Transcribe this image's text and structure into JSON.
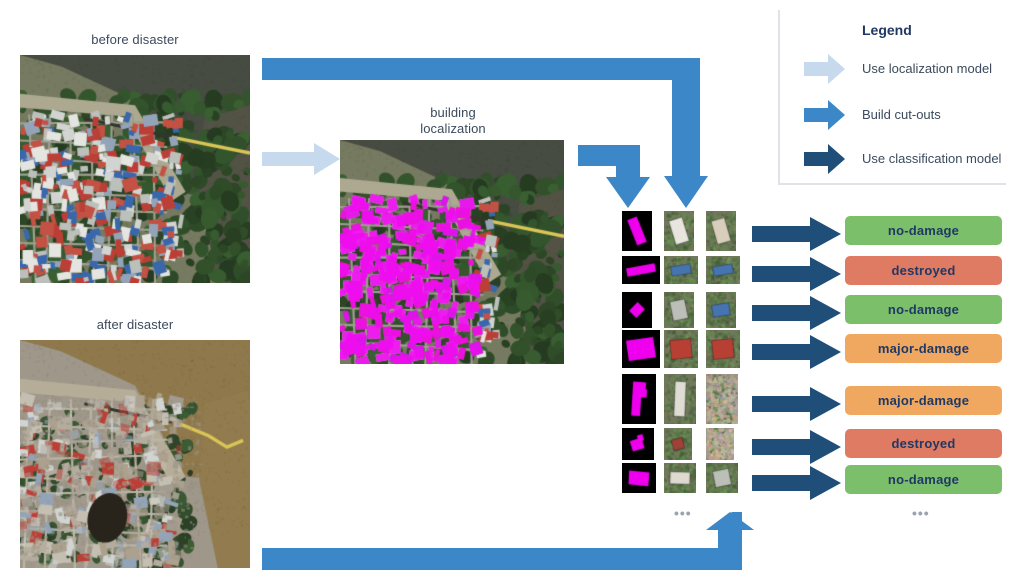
{
  "figure": {
    "captions": {
      "before": "before disaster",
      "after": "after disaster",
      "localization_line1": "building",
      "localization_line2": "localization"
    },
    "ellipsis": "•••"
  },
  "legend": {
    "title": "Legend",
    "items": [
      {
        "label": "Use localization model",
        "color": "#c6d9ed",
        "icon": "arrow-right-icon"
      },
      {
        "label": "Build cut-outs",
        "color": "#3b87c8",
        "icon": "arrow-right-icon"
      },
      {
        "label": "Use classification model",
        "color": "#1f4e79",
        "icon": "arrow-right-icon"
      }
    ]
  },
  "colors": {
    "light_blue": "#c6d9ed",
    "mid_blue": "#3b87c8",
    "dark_navy": "#1f4e79",
    "green": "#7cbf6b",
    "red": "#e07b63",
    "orange": "#f0a860",
    "badge_text": "#1f3864",
    "caption_text": "#3b4a5c",
    "mask_magenta": "#ee00ee",
    "legend_border": "#dfe3e8"
  },
  "classifications": [
    {
      "index": 1,
      "label": "no-damage",
      "color": "#7cbf6b"
    },
    {
      "index": 2,
      "label": "destroyed",
      "color": "#e07b63"
    },
    {
      "index": 3,
      "label": "no-damage",
      "color": "#7cbf6b"
    },
    {
      "index": 4,
      "label": "major-damage",
      "color": "#f0a860"
    },
    {
      "index": 5,
      "label": "major-damage",
      "color": "#f0a860"
    },
    {
      "index": 6,
      "label": "destroyed",
      "color": "#e07b63"
    },
    {
      "index": 7,
      "label": "no-damage",
      "color": "#7cbf6b"
    }
  ],
  "cutout_rows": [
    {
      "index": 1,
      "mask_shape": "tall-narrow-rotated-rect",
      "pre_roof": "white",
      "post_roof": "tan"
    },
    {
      "index": 2,
      "mask_shape": "wide-flat-rotated-bar",
      "pre_roof": "blue",
      "post_roof": "blue"
    },
    {
      "index": 3,
      "mask_shape": "small-diamond",
      "pre_roof": "grey",
      "post_roof": "blue"
    },
    {
      "index": 4,
      "mask_shape": "wide-rotated-rect",
      "pre_roof": "red",
      "post_roof": "red"
    },
    {
      "index": 5,
      "mask_shape": "tall-L-shape",
      "pre_roof": "white-long",
      "post_roof": "rubble"
    },
    {
      "index": 6,
      "mask_shape": "small-angular-block",
      "pre_roof": "red-small",
      "post_roof": "rubble"
    },
    {
      "index": 7,
      "mask_shape": "wide-block",
      "pre_roof": "white-wide",
      "post_roof": "grey"
    }
  ],
  "flow_arrows": [
    {
      "name": "localization-arrow",
      "style": "straight-right",
      "color": "#c6d9ed"
    },
    {
      "name": "pre-cutout-arrow",
      "style": "right-then-down",
      "color": "#3b87c8"
    },
    {
      "name": "mask-cutout-arrow",
      "style": "right-then-down",
      "color": "#3b87c8"
    },
    {
      "name": "post-cutout-arrow",
      "style": "right-then-up",
      "color": "#3b87c8"
    }
  ]
}
